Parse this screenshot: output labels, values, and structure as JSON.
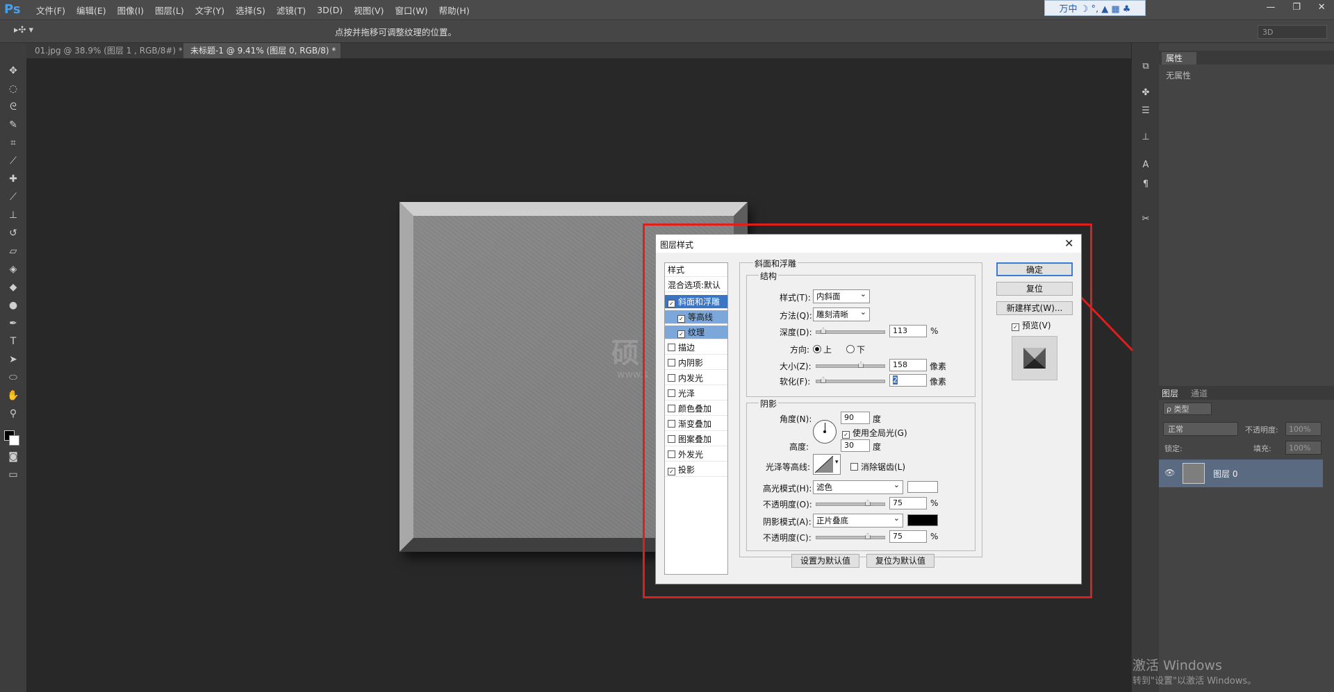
{
  "app": {
    "logo": "Ps"
  },
  "menu": [
    "文件(F)",
    "编辑(E)",
    "图像(I)",
    "图层(L)",
    "文字(Y)",
    "选择(S)",
    "滤镜(T)",
    "3D(D)",
    "视图(V)",
    "窗口(W)",
    "帮助(H)"
  ],
  "ime_bar": "万中 ☽ °, ▲ ▦ ♣",
  "window_controls": {
    "minimize": "—",
    "restore": "❐",
    "close": "✕"
  },
  "options": {
    "hint": "点按并拖移可调整纹理的位置。",
    "workspace": "3D"
  },
  "tabs": [
    {
      "label": "01.jpg @ 38.9% (图层 1 , RGB/8#) *"
    },
    {
      "label": "未标题-1 @ 9.41% (图层 0, RGB/8) *"
    }
  ],
  "canvas_watermark": {
    "main": "硕",
    "sub": "www.s"
  },
  "properties": {
    "tab": "属性",
    "empty": "无属性"
  },
  "layers": {
    "tab": "图层",
    "channels_tab": "通道",
    "filter": "ρ 类型",
    "blend_mode": "正常",
    "opacity_label": "不透明度:",
    "opacity": "100%",
    "lock_label": "锁定:",
    "fill_label": "填充:",
    "fill": "100%",
    "layer_name": "图层 0"
  },
  "windows_activation": {
    "title": "激活 Windows",
    "sub": "转到\"设置\"以激活 Windows。"
  },
  "dialog": {
    "title": "图层样式",
    "styles_header": "样式",
    "blend_options": "混合选项:默认",
    "styles": [
      {
        "label": "斜面和浮雕",
        "checked": "✓"
      },
      {
        "label": "等高线",
        "checked": "✓"
      },
      {
        "label": "纹理",
        "checked": "✓"
      },
      {
        "label": "描边",
        "checked": ""
      },
      {
        "label": "内阴影",
        "checked": ""
      },
      {
        "label": "内发光",
        "checked": ""
      },
      {
        "label": "光泽",
        "checked": ""
      },
      {
        "label": "颜色叠加",
        "checked": ""
      },
      {
        "label": "渐变叠加",
        "checked": ""
      },
      {
        "label": "图案叠加",
        "checked": ""
      },
      {
        "label": "外发光",
        "checked": ""
      },
      {
        "label": "投影",
        "checked": "✓"
      }
    ],
    "section_title": "斜面和浮雕",
    "structure": {
      "title": "结构",
      "style_label": "样式(T):",
      "style_value": "内斜面",
      "method_label": "方法(Q):",
      "method_value": "雕刻清晰",
      "depth_label": "深度(D):",
      "depth_value": "113",
      "depth_unit": "%",
      "direction_label": "方向:",
      "dir_up": "上",
      "dir_down": "下",
      "size_label": "大小(Z):",
      "size_value": "158",
      "size_unit": "像素",
      "soften_label": "软化(F):",
      "soften_value": "2",
      "soften_unit": "像素"
    },
    "shading": {
      "title": "阴影",
      "angle_label": "角度(N):",
      "angle_value": "90",
      "angle_unit": "度",
      "global_light": "使用全局光(G)",
      "altitude_label": "高度:",
      "altitude_value": "30",
      "altitude_unit": "度",
      "gloss_label": "光泽等高线:",
      "anti_alias": "消除锯齿(L)",
      "highlight_mode_label": "高光模式(H):",
      "highlight_mode": "滤色",
      "highlight_opacity_label": "不透明度(O):",
      "highlight_opacity": "75",
      "highlight_color": "#ffffff",
      "shadow_mode_label": "阴影模式(A):",
      "shadow_mode": "正片叠底",
      "shadow_opacity_label": "不透明度(C):",
      "shadow_opacity": "75",
      "shadow_color": "#000000",
      "pct": "%"
    },
    "set_default": "设置为默认值",
    "reset_default": "复位为默认值",
    "ok": "确定",
    "reset": "复位",
    "new_style": "新建样式(W)...",
    "preview": "预览(V)"
  },
  "accent": {
    "highlight": "#e11d1d",
    "selection": "#3a74c4"
  }
}
